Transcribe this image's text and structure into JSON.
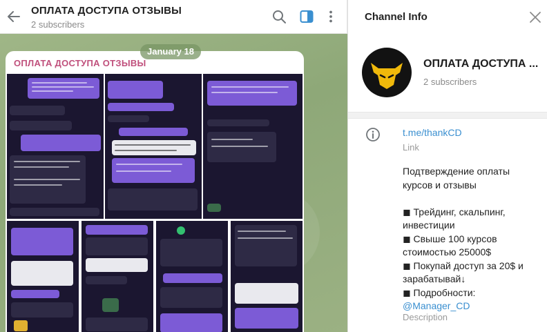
{
  "chat": {
    "title": "ОПЛАТА ДОСТУПА ОТЗЫВЫ",
    "subscribers": "2 subscribers",
    "date": "January 18",
    "post_author": "ОПЛАТА ДОСТУПА ОТЗЫВЫ"
  },
  "info": {
    "title": "Channel Info",
    "channel_name": "ОПЛАТА ДОСТУПА ...",
    "subscribers": "2 subscribers",
    "link": "t.me/thankCD",
    "link_label": "Link",
    "desc_intro": "Подтверждение оплаты курсов и отзывы",
    "desc_lines": [
      "◼ Трейдинг, скальпинг, инвестиции",
      "◼ Свыше 100 курсов стоимостью 25000$",
      "◼ Покупай доступ за 20$ и зарабатывай↓",
      "◼ Подробности:"
    ],
    "mention": "@Manager_CD",
    "desc_label": "Description"
  },
  "colors": {
    "accent_link": "#3a8fd0",
    "author": "#c0507c",
    "header_icon_active": "#3a8fd0"
  },
  "icons": {
    "back": "arrow-left-icon",
    "search": "search-icon",
    "sidebar": "sidebar-toggle-icon",
    "more": "more-vertical-icon",
    "close": "close-icon",
    "info": "info-circle-icon"
  }
}
